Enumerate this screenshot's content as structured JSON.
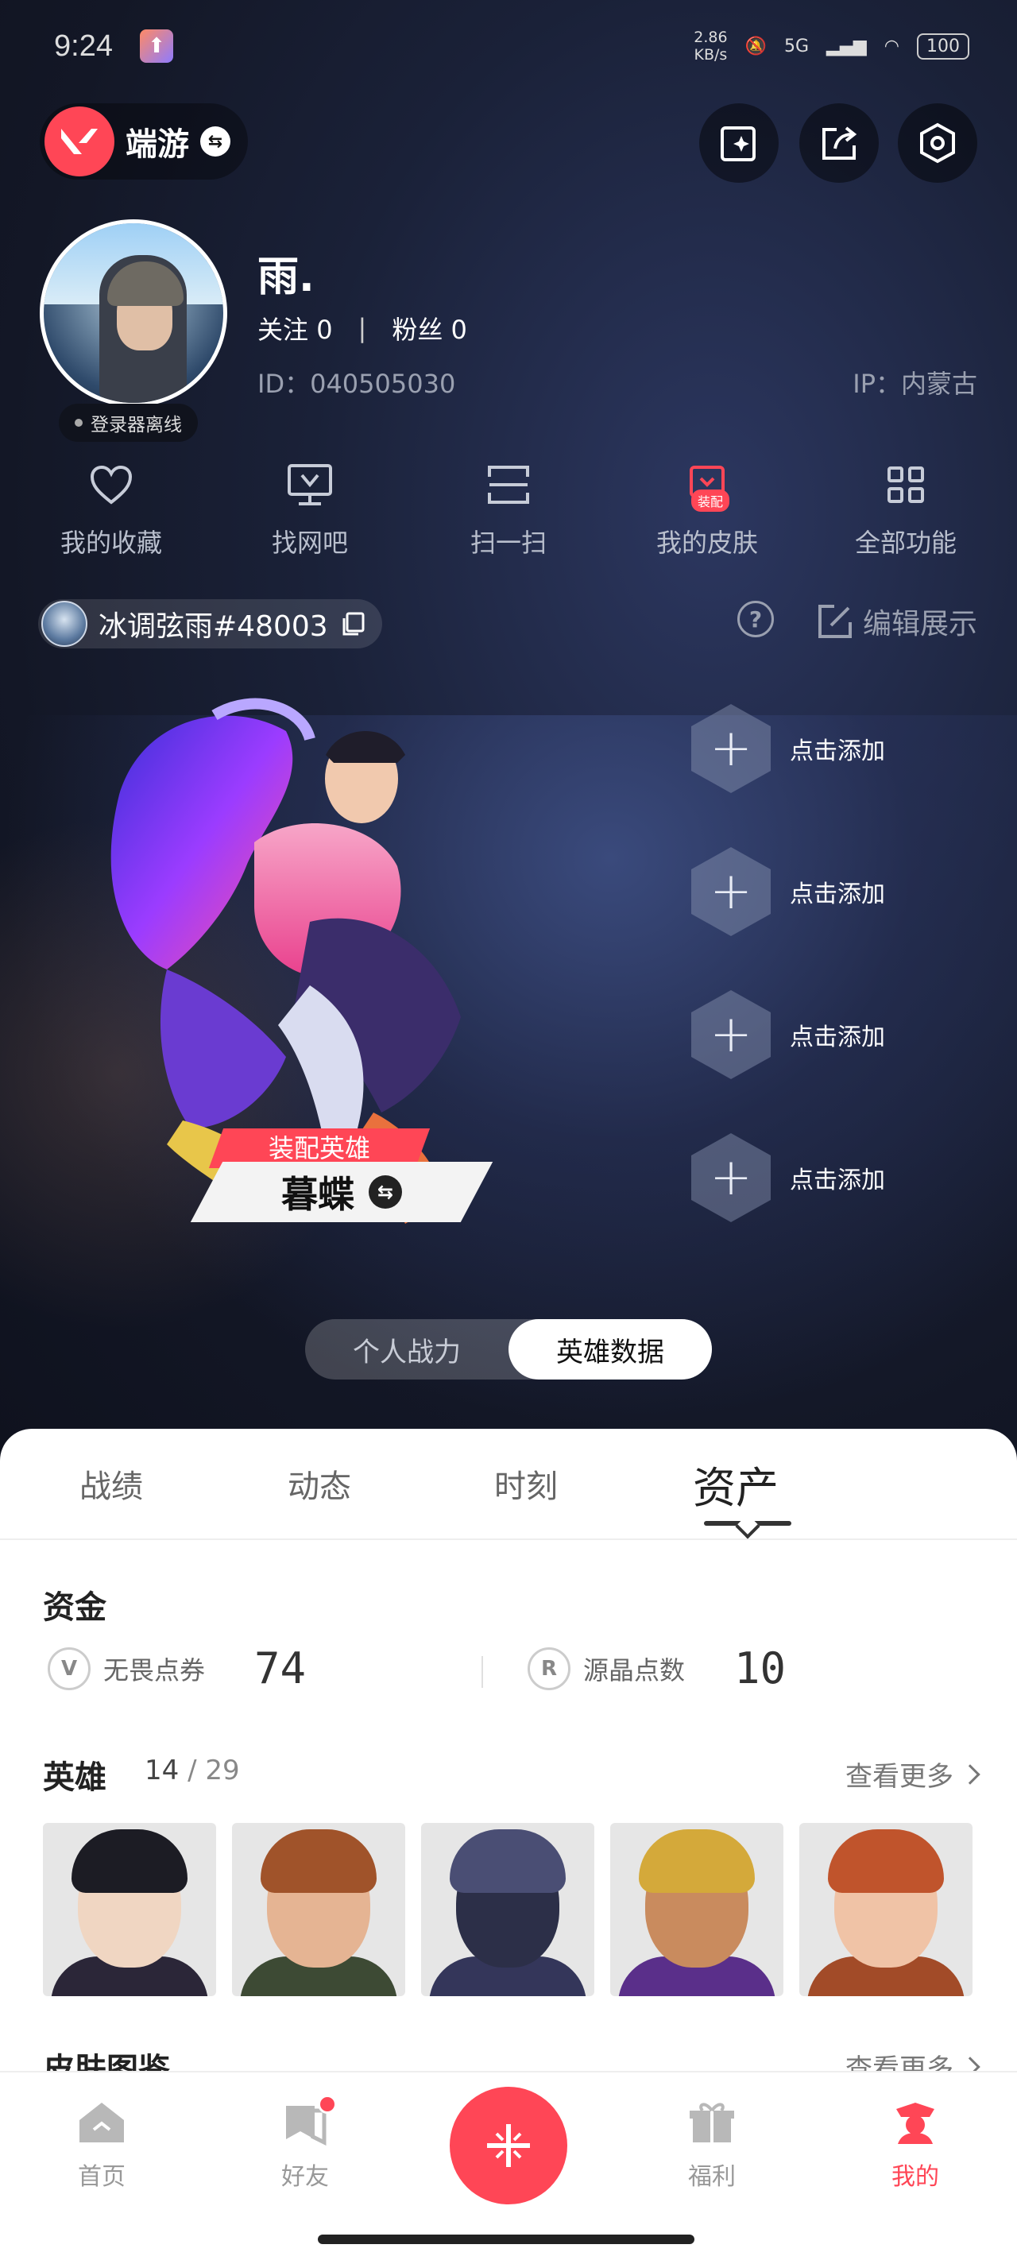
{
  "status_bar": {
    "time": "9:24",
    "speed_top": "2.86",
    "speed_bottom": "KB/s",
    "network": "5G",
    "battery": "100"
  },
  "header": {
    "game_name": "端游"
  },
  "profile": {
    "nickname": "雨.",
    "follow_label": "关注",
    "follow_count": "0",
    "fans_label": "粉丝",
    "fans_count": "0",
    "id_text": "ID：040505030",
    "ip_text": "IP：内蒙古",
    "status_pill": "登录器离线"
  },
  "quick_actions": [
    {
      "label": "我的收藏",
      "icon": "heart-icon"
    },
    {
      "label": "找网吧",
      "icon": "monitor-icon"
    },
    {
      "label": "扫一扫",
      "icon": "scan-icon"
    },
    {
      "label": "我的皮肤",
      "icon": "skin-icon",
      "badge": "装配"
    },
    {
      "label": "全部功能",
      "icon": "grid-icon"
    }
  ],
  "riot_id": "冰调弦雨#48003",
  "edit_showcase": "编辑展示",
  "showcase": {
    "equip_tag": "装配英雄",
    "hero_name": "暮蝶",
    "slots": [
      "点击添加",
      "点击添加",
      "点击添加",
      "点击添加"
    ]
  },
  "segment": {
    "options": [
      "个人战力",
      "英雄数据"
    ],
    "selected": "英雄数据"
  },
  "tabs": [
    "战绩",
    "动态",
    "时刻",
    "资产"
  ],
  "active_tab": "资产",
  "funds": {
    "title": "资金",
    "items": [
      {
        "label": "无畏点券",
        "value": "74",
        "icon": "valorant-points-icon"
      },
      {
        "label": "源晶点数",
        "value": "10",
        "icon": "radianite-icon"
      }
    ]
  },
  "heroes": {
    "title": "英雄",
    "owned": "14",
    "total": "/ 29",
    "more": "查看更多"
  },
  "skins_peek": {
    "title": "皮肤图鉴",
    "more": "查看更多"
  },
  "bottom_nav": [
    {
      "label": "首页",
      "icon": "home-icon"
    },
    {
      "label": "好友",
      "icon": "friends-icon"
    },
    {
      "label": "福利",
      "icon": "gift-icon"
    },
    {
      "label": "我的",
      "icon": "profile-icon"
    }
  ],
  "colors": {
    "accent": "#ff4656",
    "background_dark": "#16182a",
    "sheet": "#ffffff"
  }
}
